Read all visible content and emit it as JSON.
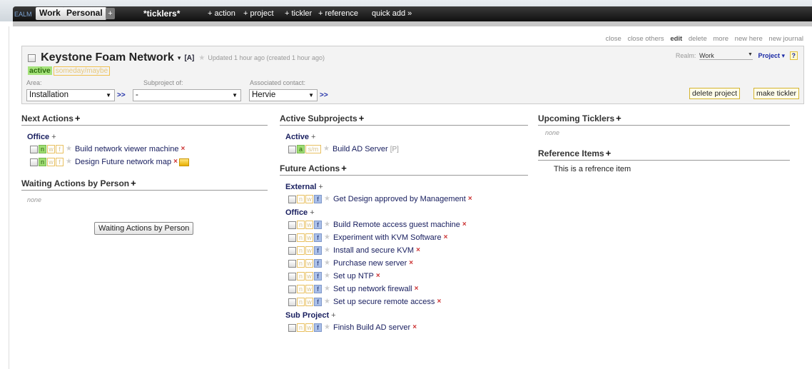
{
  "topbar": {
    "logo": "EALM",
    "tabs": [
      "Work",
      "Personal"
    ],
    "add_tab": "+",
    "ticklers": "*ticklers*",
    "links": [
      "+ action",
      "+ project",
      "+ tickler",
      "+ reference",
      "quick add »"
    ]
  },
  "window_links": [
    "close",
    "close others",
    "edit",
    "delete",
    "more",
    "new here",
    "new journal"
  ],
  "project": {
    "name": "Keystone Foam Network",
    "menu_arrow": "▾",
    "flag": "[A]",
    "updated": "Updated 1 hour ago (created 1 hour ago)",
    "status_active": "active",
    "status_someday": "someday/maybe",
    "area_label": "Area:",
    "area_value": "Installation",
    "subproject_label": "Subproject of:",
    "subproject_value": "-",
    "contact_label": "Associated contact:",
    "contact_value": "Hervie",
    "go": ">>",
    "realm_label": "Realm:",
    "realm_value": "Work",
    "project_menu": "Project ▾",
    "help": "?",
    "delete_button": "delete project",
    "tickler_button": "make tickler"
  },
  "next_actions": {
    "title": "Next Actions",
    "plus": "+",
    "groups": [
      {
        "name": "Office",
        "items": [
          "Build network viewer machine",
          "Design Future network map"
        ]
      }
    ]
  },
  "waiting": {
    "title": "Waiting Actions by Person",
    "plus": "+",
    "none": "none",
    "button": "Waiting Actions by Person"
  },
  "subprojects": {
    "title": "Active Subprojects",
    "plus": "+",
    "group": "Active",
    "tag_a": "a",
    "tag_sm": "s/m",
    "item": "Build AD Server",
    "item_flag": "[P]"
  },
  "future_actions": {
    "title": "Future Actions",
    "plus": "+",
    "groups": [
      {
        "name": "External",
        "items": [
          "Get Design approved by Management"
        ]
      },
      {
        "name": "Office",
        "items": [
          "Build Remote access guest machine",
          "Experiment with KVM Software",
          "Install and secure KVM",
          "Purchase new server",
          "Set up NTP",
          "Set up network firewall",
          "Set up secure remote access"
        ]
      },
      {
        "name": "Sub Project",
        "items": [
          "Finish Build AD server"
        ]
      }
    ]
  },
  "ticklers": {
    "title": "Upcoming Ticklers",
    "plus": "+",
    "none": "none"
  },
  "references": {
    "title": "Reference Items",
    "plus": "+",
    "items": [
      "This is a refrence item"
    ]
  },
  "tags": {
    "n": "n",
    "w": "w",
    "f": "f"
  },
  "icons": {
    "star": "★",
    "delete": "×",
    "plus": "+"
  }
}
